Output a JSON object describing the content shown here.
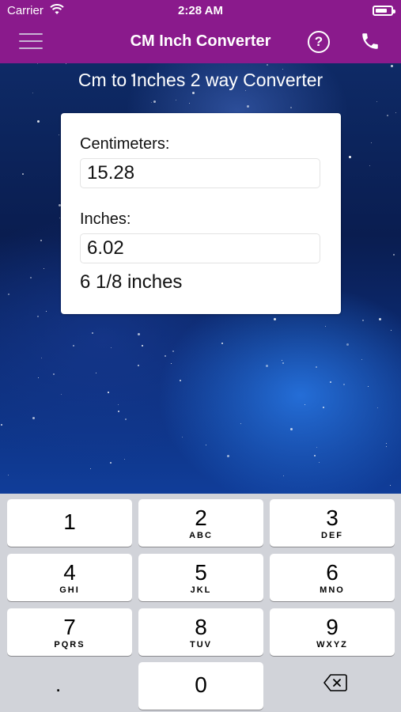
{
  "status_bar": {
    "carrier": "Carrier",
    "time": "2:28 AM"
  },
  "nav": {
    "title": "CM Inch Converter"
  },
  "heading": "Cm to Inches 2 way Converter",
  "form": {
    "cm_label": "Centimeters:",
    "cm_value": "15.28",
    "inch_label": "Inches:",
    "inch_value": "6.02",
    "fraction": "6 1/8 inches"
  },
  "keypad": {
    "keys": [
      {
        "num": "1",
        "letters": ""
      },
      {
        "num": "2",
        "letters": "ABC"
      },
      {
        "num": "3",
        "letters": "DEF"
      },
      {
        "num": "4",
        "letters": "GHI"
      },
      {
        "num": "5",
        "letters": "JKL"
      },
      {
        "num": "6",
        "letters": "MNO"
      },
      {
        "num": "7",
        "letters": "PQRS"
      },
      {
        "num": "8",
        "letters": "TUV"
      },
      {
        "num": "9",
        "letters": "WXYZ"
      },
      {
        "num": "0",
        "letters": ""
      }
    ],
    "dot": "."
  },
  "colors": {
    "nav_bg": "#8a1a8c",
    "keyboard_bg": "#d1d3d9"
  },
  "icons": [
    "wifi-icon",
    "battery-icon",
    "menu-icon",
    "help-icon",
    "phone-icon",
    "delete-icon"
  ]
}
